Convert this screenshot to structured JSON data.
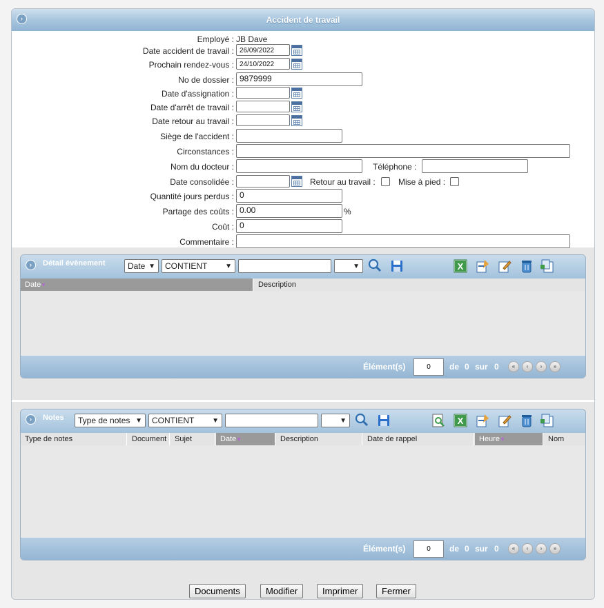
{
  "window": {
    "title": "Accident de travail"
  },
  "form": {
    "employe_label": "Employé :",
    "employe_value": "JB Dave",
    "date_accident_label": "Date accident de travail :",
    "date_accident_value": "26/09/2022",
    "prochain_rdv_label": "Prochain rendez-vous :",
    "prochain_rdv_value": "24/10/2022",
    "no_dossier_label": "No de dossier :",
    "no_dossier_value": "9879999",
    "date_assignation_label": "Date d'assignation :",
    "date_arret_label": "Date d'arrêt de travail :",
    "date_retour_label": "Date retour au travail :",
    "siege_label": "Siège de l'accident :",
    "circonstances_label": "Circonstances :",
    "docteur_label": "Nom du docteur :",
    "telephone_label": "Téléphone :",
    "date_consolidee_label": "Date consolidée :",
    "retour_travail_label": "Retour au travail :",
    "mise_a_pied_label": "Mise à pied :",
    "jours_perdus_label": "Quantité jours perdus :",
    "jours_perdus_value": "0",
    "partage_label": "Partage des coûts :",
    "partage_value": "0.00",
    "partage_unit": "%",
    "cout_label": "Coût :",
    "cout_value": "0",
    "commentaire_label": "Commentaire :"
  },
  "detail_panel": {
    "title": "Détail évènement",
    "filter_field": "Date",
    "filter_op": "CONTIENT",
    "columns": [
      "Date",
      "Description"
    ],
    "footer_label": "Élément(s)",
    "page_value": "0",
    "de_label": "de",
    "de_value": "0",
    "sur_label": "sur",
    "sur_value": "0"
  },
  "notes_panel": {
    "title": "Notes",
    "filter_field": "Type de notes",
    "filter_op": "CONTIENT",
    "columns": [
      "Type de notes",
      "Document",
      "Sujet",
      "Date",
      "Description",
      "Date de rappel",
      "Heure",
      "Nom"
    ],
    "footer_label": "Élément(s)",
    "page_value": "0",
    "de_label": "de",
    "de_value": "0",
    "sur_label": "sur",
    "sur_value": "0"
  },
  "buttons": {
    "documents": "Documents",
    "modifier": "Modifier",
    "imprimer": "Imprimer",
    "fermer": "Fermer"
  },
  "icons": {
    "search": "search-icon",
    "save": "save-icon",
    "excel": "excel-icon",
    "add": "add-icon",
    "edit": "edit-icon",
    "delete": "trash-icon",
    "copy": "copy-icon",
    "preview": "preview-icon",
    "calendar": "calendar-icon"
  }
}
